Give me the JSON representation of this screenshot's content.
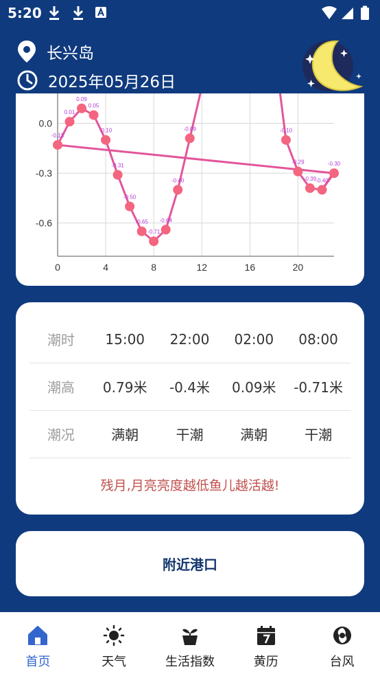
{
  "status_bar": {
    "time": "5:20",
    "left_icons": [
      "download-icon",
      "download-icon",
      "text-app-icon"
    ],
    "right_icons": [
      "wifi-icon",
      "signal-icon",
      "battery-icon"
    ]
  },
  "header": {
    "location": "长兴岛",
    "date": "2025年05月26日",
    "location_icon": "location-pin-icon",
    "date_icon": "clock-icon",
    "moon_icon": "crescent-moon-icon"
  },
  "chart_data": {
    "type": "line",
    "xlim": [
      0,
      23
    ],
    "ylim": [
      -0.8,
      0.18
    ],
    "x_ticks": [
      0,
      4,
      8,
      12,
      16,
      20
    ],
    "y_ticks": [
      0.0,
      -0.3,
      -0.6
    ],
    "y_tick_labels": [
      "0.0",
      "-0.3",
      "-0.6"
    ],
    "grid": true,
    "series": [
      {
        "color": "#e3559a",
        "marker_color": "#f4657f",
        "label_color": "#b23ad6",
        "points": [
          {
            "x": 0,
            "y": -0.13,
            "label": "-0.13"
          },
          {
            "x": 1,
            "y": 0.01,
            "label": "0.01"
          },
          {
            "x": 2,
            "y": 0.09,
            "label": "0.09"
          },
          {
            "x": 3,
            "y": 0.05,
            "label": "0.05"
          },
          {
            "x": 4,
            "y": -0.1,
            "label": "-0.10"
          },
          {
            "x": 5,
            "y": -0.31,
            "label": "-0.31"
          },
          {
            "x": 6,
            "y": -0.5,
            "label": "-0.50"
          },
          {
            "x": 7,
            "y": -0.65,
            "label": "-0.65"
          },
          {
            "x": 8,
            "y": -0.71,
            "label": "-0.71"
          },
          {
            "x": 9,
            "y": -0.64,
            "label": "-0.64"
          },
          {
            "x": 10,
            "y": -0.4,
            "label": "-0.40"
          },
          {
            "x": 11,
            "y": -0.09,
            "label": "-0.09"
          },
          {
            "x": 19,
            "y": -0.1,
            "label": "-0.10"
          },
          {
            "x": 20,
            "y": -0.29,
            "label": "-0.29"
          },
          {
            "x": 21,
            "y": -0.39,
            "label": "-0.39"
          },
          {
            "x": 22,
            "y": -0.4,
            "label": "-0.40"
          },
          {
            "x": 23,
            "y": -0.3,
            "label": "-0.30"
          }
        ]
      }
    ]
  },
  "tide_table": {
    "rows": [
      {
        "label": "潮时",
        "values": [
          "15:00",
          "22:00",
          "02:00",
          "08:00"
        ]
      },
      {
        "label": "潮高",
        "values": [
          "0.79米",
          "-0.4米",
          "0.09米",
          "-0.71米"
        ]
      },
      {
        "label": "潮况",
        "values": [
          "满朝",
          "干潮",
          "满朝",
          "干潮"
        ]
      }
    ],
    "tip": "残月,月亮亮度越低鱼儿越活越!"
  },
  "nearby_port": {
    "label": "附近港口"
  },
  "bottom_nav": {
    "active_color": "#3366cc",
    "items": [
      {
        "label": "首页",
        "icon": "home-icon",
        "active": true
      },
      {
        "label": "天气",
        "icon": "sun-icon",
        "active": false
      },
      {
        "label": "生活指数",
        "icon": "plant-pot-icon",
        "active": false
      },
      {
        "label": "黄历",
        "icon": "calendar-icon",
        "active": false
      },
      {
        "label": "台风",
        "icon": "typhoon-icon",
        "active": false
      }
    ]
  }
}
